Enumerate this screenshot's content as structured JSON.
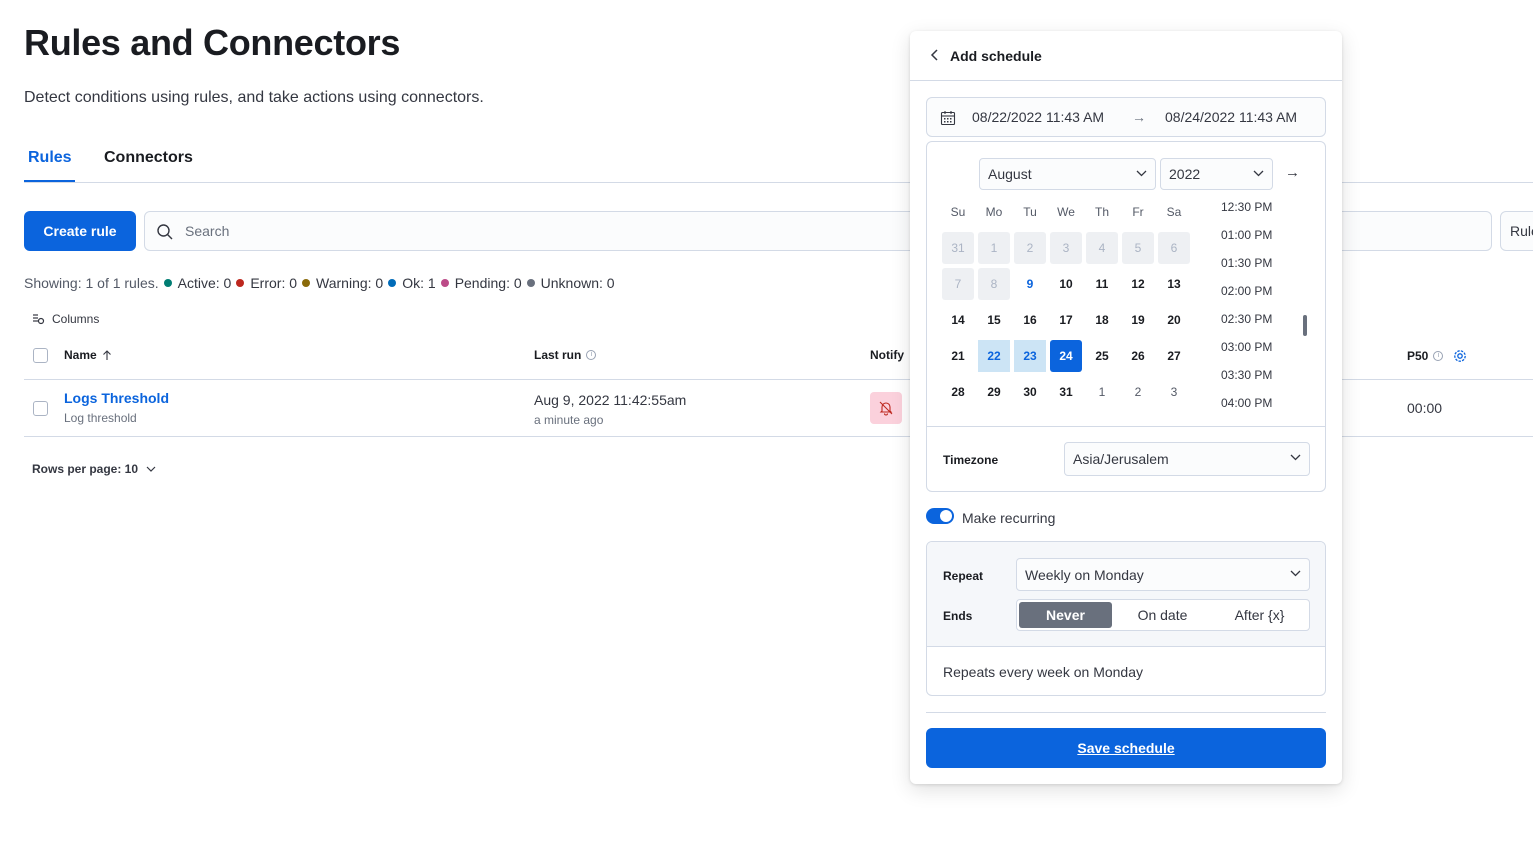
{
  "page": {
    "title": "Rules and Connectors",
    "description": "Detect conditions using rules, and take actions using connectors."
  },
  "tabs": [
    {
      "label": "Rules",
      "active": true
    },
    {
      "label": "Connectors",
      "active": false
    }
  ],
  "toolbar": {
    "create_label": "Create rule",
    "search_placeholder": "Search",
    "rule_filter_label": "Rule"
  },
  "stats": {
    "showing": "Showing: 1 of 1 rules.",
    "items": [
      {
        "label": "Active: 0",
        "color": "#017d73"
      },
      {
        "label": "Error: 0",
        "color": "#bd271e"
      },
      {
        "label": "Warning: 0",
        "color": "#8a6a0a"
      },
      {
        "label": "Ok: 1",
        "color": "#006bb8"
      },
      {
        "label": "Pending: 0",
        "color": "#bc4b88"
      },
      {
        "label": "Unknown: 0",
        "color": "#69707d"
      }
    ]
  },
  "table": {
    "columns_label": "Columns",
    "headers": {
      "name": "Name",
      "last_run": "Last run",
      "notify": "Notify",
      "p50": "P50"
    },
    "rows": [
      {
        "name": "Logs Threshold",
        "type": "Log threshold",
        "last_run": "Aug 9, 2022 11:42:55am",
        "last_run_relative": "a minute ago",
        "p50": "00:00"
      }
    ],
    "rows_per_page": "Rows per page: 10"
  },
  "popover": {
    "title": "Add schedule",
    "range_start": "08/22/2022 11:43 AM",
    "range_end": "08/24/2022 11:43 AM",
    "month": "August",
    "year": "2022",
    "weekdays": [
      "Su",
      "Mo",
      "Tu",
      "We",
      "Th",
      "Fr",
      "Sa"
    ],
    "weeks": [
      [
        "31",
        "1",
        "2",
        "3",
        "4",
        "5",
        "6"
      ],
      [
        "7",
        "8",
        "9",
        "10",
        "11",
        "12",
        "13"
      ],
      [
        "14",
        "15",
        "16",
        "17",
        "18",
        "19",
        "20"
      ],
      [
        "21",
        "22",
        "23",
        "24",
        "25",
        "26",
        "27"
      ],
      [
        "28",
        "29",
        "30",
        "31",
        "1",
        "2",
        "3"
      ]
    ],
    "times": [
      "12:30 PM",
      "01:00 PM",
      "01:30 PM",
      "02:00 PM",
      "02:30 PM",
      "03:00 PM",
      "03:30 PM",
      "04:00 PM"
    ],
    "timezone_label": "Timezone",
    "timezone": "Asia/Jerusalem",
    "recurring_label": "Make recurring",
    "recurring": true,
    "repeat_label": "Repeat",
    "repeat_value": "Weekly on Monday",
    "ends_label": "Ends",
    "ends_options": [
      {
        "label": "Never",
        "active": true
      },
      {
        "label": "On date",
        "active": false
      },
      {
        "label": "After {x}",
        "active": false
      }
    ],
    "summary": "Repeats every week on Monday",
    "save_label": "Save schedule"
  },
  "colors": {
    "accent": "#0b64dd",
    "notify_bg": "#fbd1dc",
    "range_bg": "#cce4f5"
  }
}
